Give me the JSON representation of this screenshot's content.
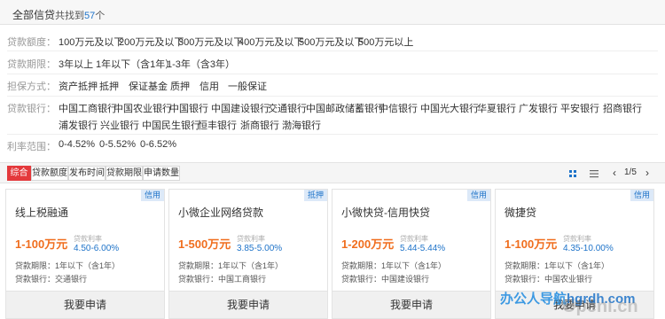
{
  "header": {
    "title": "全部信贷",
    "count_prefix": "共找到",
    "count_num": "57",
    "count_suffix": "个"
  },
  "filters": {
    "amount": {
      "label": "贷款额度：",
      "options": [
        "100万元及以下",
        "200万元及以下",
        "300万元及以下",
        "400万元及以下",
        "500万元及以下",
        "500万元以上"
      ]
    },
    "term": {
      "label": "贷款期限：",
      "options": [
        "3年以上",
        "1年以下（含1年）",
        "1-3年（含3年）"
      ]
    },
    "guarantee": {
      "label": "担保方式：",
      "options": [
        "资产抵押",
        "抵押",
        "保证基金",
        "质押",
        "信用",
        "一般保证"
      ]
    },
    "bank": {
      "label": "贷款银行：",
      "options": [
        "中国工商银行",
        "中国农业银行",
        "中国银行",
        "中国建设银行",
        "交通银行",
        "中国邮政储蓄银行",
        "中信银行",
        "中国光大银行",
        "华夏银行",
        "广发银行",
        "平安银行",
        "招商银行",
        "浦发银行",
        "兴业银行",
        "中国民生银行",
        "恒丰银行",
        "浙商银行",
        "渤海银行"
      ]
    },
    "rate": {
      "label": "利率范围：",
      "options": [
        "0-4.52%",
        "0-5.52%",
        "0-6.52%"
      ]
    }
  },
  "sortbar": {
    "buttons": [
      "综合",
      "贷款额度",
      "发布时间",
      "贷款期限",
      "申请数量"
    ],
    "page": "1/5",
    "prev": "‹",
    "next": "›"
  },
  "cards": [
    {
      "tag": "信用",
      "name": "线上税融通",
      "amount": "1-100万元",
      "rate_label": "贷款利率",
      "rate": "4.50-6.00%",
      "term": "贷款期限：1年以下（含1年）",
      "bank": "贷款银行：交通银行",
      "apply": "我要申请"
    },
    {
      "tag": "抵押",
      "name": "小微企业网络贷款",
      "amount": "1-500万元",
      "rate_label": "贷款利率",
      "rate": "3.85-5.00%",
      "term": "贷款期限：1年以下（含1年）",
      "bank": "贷款银行：中国工商银行",
      "apply": "我要申请"
    },
    {
      "tag": "信用",
      "name": "小微快贷-信用快贷",
      "amount": "1-200万元",
      "rate_label": "贷款利率",
      "rate": "5.44-5.44%",
      "term": "贷款期限：1年以下（含1年）",
      "bank": "贷款银行：中国建设银行",
      "apply": "我要申请"
    },
    {
      "tag": "信用",
      "name": "微捷贷",
      "amount": "1-100万元",
      "rate_label": "贷款利率",
      "rate": "4.35-10.00%",
      "term": "贷款期限：1年以下（含1年）",
      "bank": "贷款银行：中国农业银行",
      "apply": "我要申请"
    }
  ],
  "watermark": {
    "text": "办公人导航",
    "url": "hgrdh.com",
    "text2": "Openi.cn"
  },
  "colors": {
    "accent": "#e4393c",
    "link": "#1e73c9",
    "amount": "#f06e1e"
  }
}
